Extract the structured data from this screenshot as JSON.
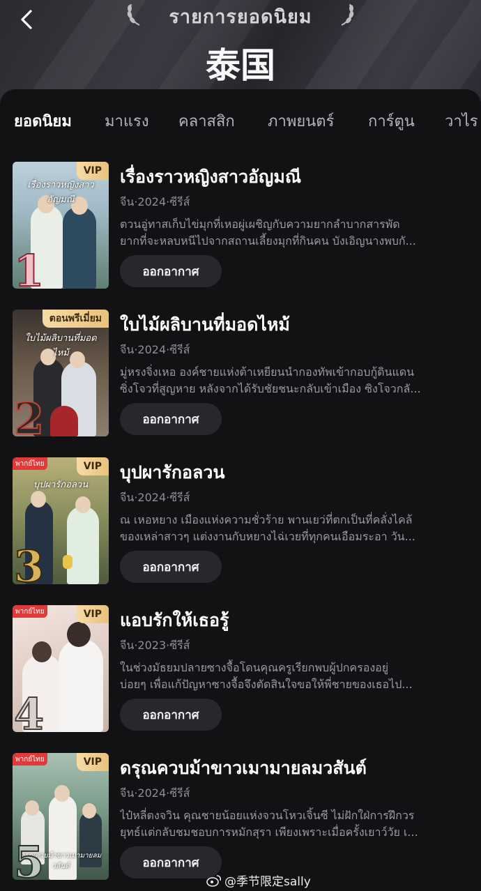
{
  "header": {
    "ranking_label": "รายการยอดนิยม",
    "country_title": "泰国"
  },
  "tabs": [
    {
      "label": "ยอดนิยม",
      "active": true
    },
    {
      "label": "มาแรง",
      "active": false
    },
    {
      "label": "คลาสสิก",
      "active": false
    },
    {
      "label": "ภาพยนตร์",
      "active": false
    },
    {
      "label": "การ์ตูน",
      "active": false
    },
    {
      "label": "วาไร",
      "active": false
    }
  ],
  "shows": [
    {
      "rank": "1",
      "badge": "VIP",
      "dub_badge": "",
      "poster_text": "เรื่องราวหญิงสาวอัญมณี",
      "title": "เรื่องราวหญิงสาวอัญมณี",
      "meta": "จีน·2024·ซีรีส์",
      "desc_line1": "ตวนอู่ทาสเก็บไข่มุกที่เหอผู่เผชิญกับความยากลำบากสารพัด",
      "desc_line2": "ยากที่จะหลบหนีไปจากสถานเลี้ยงมุกที่กินคน บังเอิญนางพบกั...",
      "button": "ออกอากาศ"
    },
    {
      "rank": "2",
      "badge": "ตอนพรีเมี่ยม",
      "dub_badge": "",
      "poster_text": "ใบไม้ผลิบานที่มอดไหม้",
      "title": "ใบไม้ผลิบานที่มอดไหม้",
      "meta": "จีน·2024·ซีรีส์",
      "desc_line1": "มู่หรงจิ่งเหอ องค์ชายแห่งต้าเหยียนนำกองทัพเข้ากอบกู้ดินแดน",
      "desc_line2": "ซิ่งโจวที่สูญหาย หลังจากได้รับชัยชนะกลับเข้าเมือง ซิงโจวกลั...",
      "button": "ออกอากาศ"
    },
    {
      "rank": "3",
      "badge": "VIP",
      "dub_badge": "พากย์ไทย",
      "poster_text": "บุปผารักอลวน",
      "title": "บุปผารักอลวน",
      "meta": "จีน·2024·ซีรีส์",
      "desc_line1": "ณ เหอหยาง เมืองแห่งความชั่วร้าย พานเยว่ที่ตกเป็นที่คลั่งไคล้",
      "desc_line2": "ของเหล่าสาวๆ แต่งงานกับหยางไฉ่เวยที่ทุกคนเอือมระอา วัน...",
      "button": "ออกอากาศ"
    },
    {
      "rank": "4",
      "badge": "VIP",
      "dub_badge": "พากย์ไทย",
      "poster_text": "",
      "title": "แอบรักให้เธอรู้",
      "meta": "จีน·2023·ซีรีส์",
      "desc_line1": "ในช่วงมัธยมปลายซางจื้อโดนคุณครูเรียกพบผู้ปกครองอยู่",
      "desc_line2": "บ่อยๆ เพื่อแก้ปัญหาซางจื้อจึงตัดสินใจขอให้พี่ชายของเธอไป...",
      "button": "ออกอากาศ"
    },
    {
      "rank": "5",
      "badge": "VIP",
      "dub_badge": "พากย์ไทย",
      "poster_text": "ดรุณควบม้าขาวเมามายลมวสันต์",
      "title": "ดรุณควบม้าขาวเมามายลมวสันต์",
      "meta": "จีน·2024·ซีรีส์",
      "desc_line1": "ไป๋หลี่ตงจวิน คุณชายน้อยแห่งจวนโหวเจิ้นซี ไม่ฝักใฝ่การฝึกวร",
      "desc_line2": "ยุทธ์แต่กลับชมชอบการหมักสุรา เพียงเพราะเมื่อครั้งเยาว์วัย เ...",
      "button": "ออกอากาศ"
    }
  ],
  "watermark": "@季节限定sally",
  "colors": {
    "background": "#121215",
    "vip_gold": "#e9c27a",
    "button_bg": "#27272c",
    "dub_red": "#e03a3a"
  },
  "icons": {
    "back": "chevron-left-icon",
    "laurel": "laurel-icon",
    "weibo": "weibo-icon"
  }
}
